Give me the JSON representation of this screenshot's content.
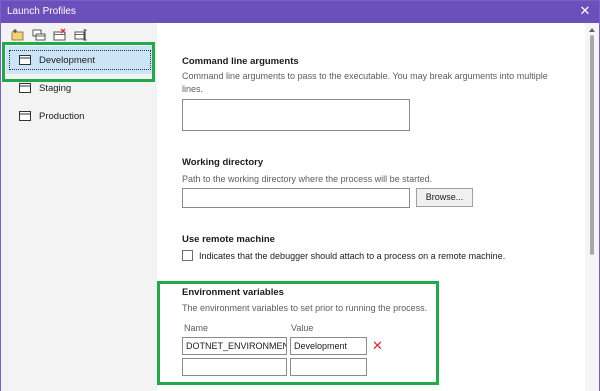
{
  "window": {
    "title": "Launch Profiles",
    "close_glyph": "✕"
  },
  "toolbar": {
    "buttons": [
      {
        "icon": "new-profile-icon"
      },
      {
        "icon": "duplicate-profile-icon"
      },
      {
        "icon": "delete-profile-icon"
      },
      {
        "icon": "rename-profile-icon"
      }
    ]
  },
  "profiles": [
    {
      "label": "Development",
      "selected": true
    },
    {
      "label": "Staging",
      "selected": false
    },
    {
      "label": "Production",
      "selected": false
    }
  ],
  "sections": {
    "command_line": {
      "title": "Command line arguments",
      "description": "Command line arguments to pass to the executable. You may break arguments into multiple lines.",
      "value": ""
    },
    "working_directory": {
      "title": "Working directory",
      "description": "Path to the working directory where the process will be started.",
      "value": "",
      "browse_label": "Browse..."
    },
    "remote_machine": {
      "title": "Use remote machine",
      "checkbox_label": "Indicates that the debugger should attach to a process on a remote machine.",
      "checked": false
    },
    "environment": {
      "title": "Environment variables",
      "description": "The environment variables to set prior to running the process.",
      "name_header": "Name",
      "value_header": "Value",
      "rows": [
        {
          "name": "DOTNET_ENVIRONMENT",
          "value": "Development",
          "remove_glyph": "✕"
        },
        {
          "name": "",
          "value": ""
        }
      ]
    }
  },
  "colors": {
    "titlebar": "#6b4fbb",
    "highlight": "#21a94a",
    "selected": "#cce4f7",
    "remove": "#e5282b"
  }
}
